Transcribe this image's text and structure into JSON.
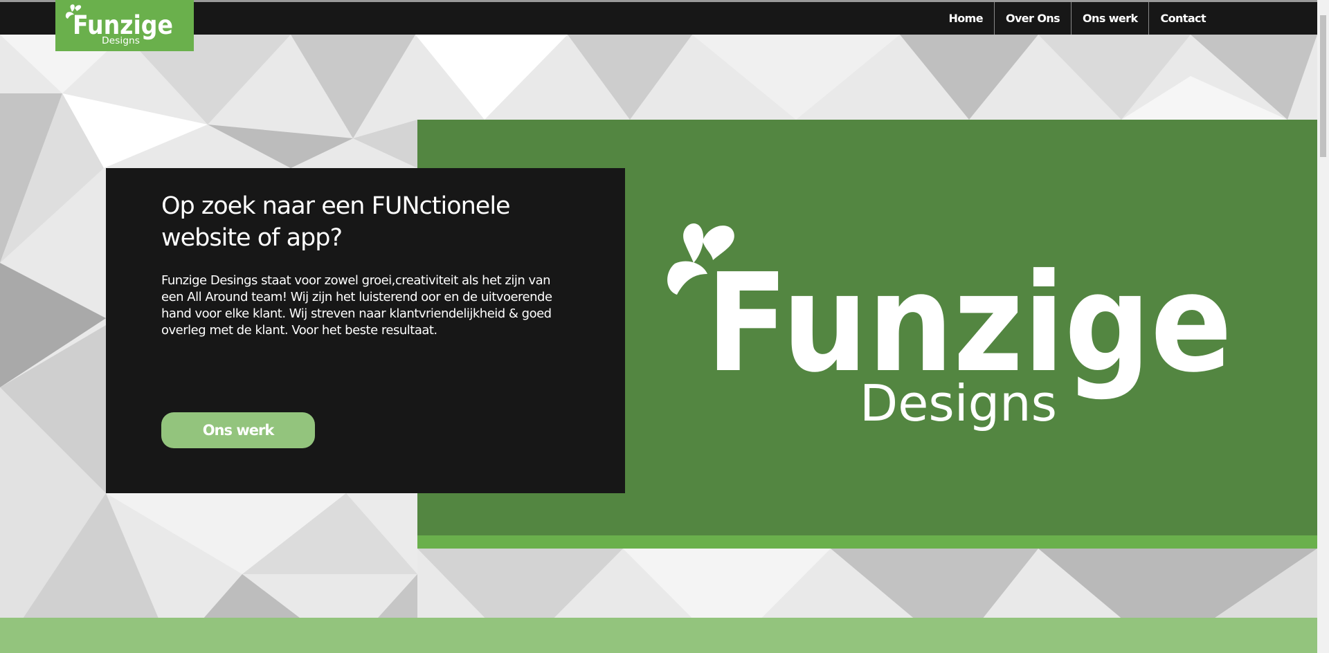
{
  "colors": {
    "navbar": "#171717",
    "brand_green": "#6ab04c",
    "panel_green": "#538641",
    "light_green": "#93c47d",
    "card_dark": "#171717",
    "text": "#ffffff"
  },
  "nav": {
    "logo": {
      "main": "Funzige",
      "sub": "Designs"
    },
    "items": [
      {
        "label": "Home"
      },
      {
        "label": "Over Ons"
      },
      {
        "label": "Ons werk"
      },
      {
        "label": "Contact"
      }
    ]
  },
  "hero": {
    "title": "Op zoek naar een FUNctionele website of app?",
    "text": "Funzige Desings staat voor zowel groei,creativiteit als het zijn van een All Around team! Wij zijn het luisterend oor en de uitvoerende hand voor elke klant. Wij streven naar klantvriendelijkheid & goed overleg met de klant. Voor het beste resultaat.",
    "button_label": "Ons werk",
    "logo": {
      "main": "Funzige",
      "sub": "Designs"
    }
  },
  "icons": {
    "logo_splash": "splash-icon"
  }
}
